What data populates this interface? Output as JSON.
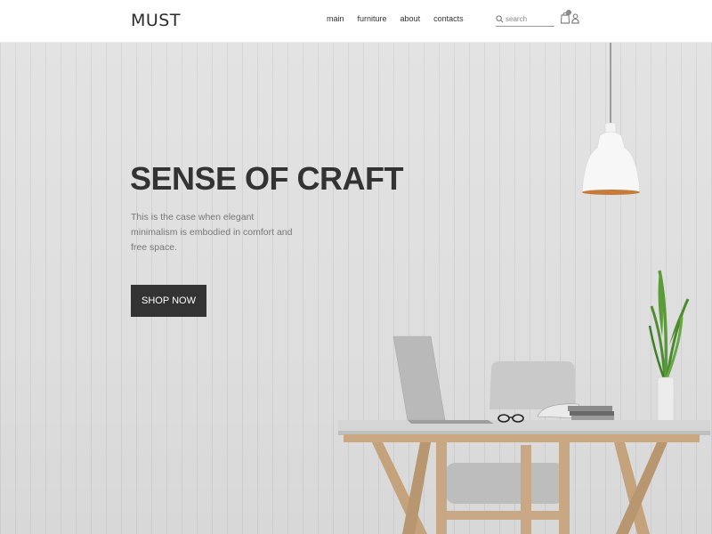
{
  "header": {
    "logo": "MUST",
    "nav": [
      {
        "label": "main"
      },
      {
        "label": "furniture"
      },
      {
        "label": "about"
      },
      {
        "label": "contacts"
      }
    ],
    "search": {
      "placeholder": "search",
      "value": ""
    }
  },
  "hero": {
    "title": "SENSE OF CRAFT",
    "subtitle": "This is the case when elegant minimalism is embodied in comfort and free space.",
    "button_label": "SHOP NOW"
  },
  "colors": {
    "text_dark": "#333333",
    "button_bg": "#333333",
    "wall": "#e0e0e0"
  },
  "icons": [
    "search-icon",
    "cart-icon",
    "user-icon"
  ]
}
